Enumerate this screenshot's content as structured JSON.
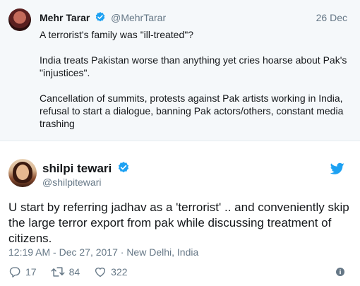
{
  "parent_tweet": {
    "author_name": "Mehr Tarar",
    "author_handle": "@MehrTarar",
    "date": "26 Dec",
    "paragraphs": [
      "A terrorist's family was \"ill-treated\"?",
      "India treats Pakistan worse than anything yet cries hoarse about Pak's \"injustices\".",
      "Cancellation of summits, protests against Pak artists working in India, refusal to start a dialogue, banning Pak actors/others, constant media trashing"
    ]
  },
  "tweet": {
    "author_name": "shilpi tewari",
    "author_handle": "@shilpitewari",
    "text": "U start by referring jadhav as a 'terrorist' .. and conveniently skip the large terror export from pak while discussing treatment of citizens.",
    "meta": "12:19 AM - Dec 27, 2017 · New Delhi, India",
    "replies": "17",
    "retweets": "84",
    "likes": "322"
  },
  "icons": {
    "verified": "verified-badge-icon",
    "twitter": "twitter-bird-icon",
    "reply": "reply-icon",
    "retweet": "retweet-icon",
    "like": "heart-icon",
    "info": "info-icon"
  },
  "colors": {
    "accent": "#1da1f2",
    "muted": "#657786",
    "text": "#14171a",
    "parent_background": "#f5f8fa"
  }
}
